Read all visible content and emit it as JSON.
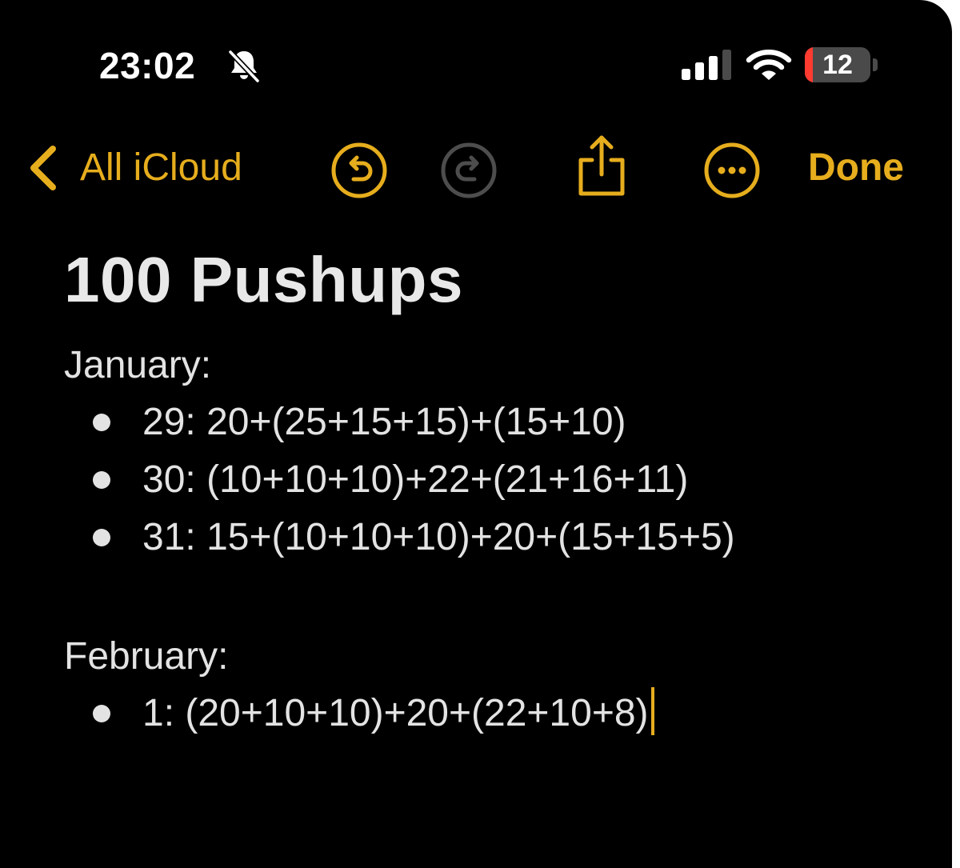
{
  "status_bar": {
    "time": "23:02",
    "silent_icon": "bell-slash-icon",
    "signal_icon": "cellular-signal-icon",
    "wifi_icon": "wifi-icon",
    "battery_percent": 12,
    "battery_label": "12",
    "battery_color": "#ff3b30"
  },
  "toolbar": {
    "back_label": "All iCloud",
    "back_icon": "chevron-left-icon",
    "undo_icon": "undo-icon",
    "redo_icon": "redo-icon",
    "redo_enabled": false,
    "share_icon": "share-icon",
    "more_icon": "more-icon",
    "done_label": "Done",
    "accent_color": "#e6ad1d"
  },
  "note": {
    "title": "100 Pushups",
    "sections": [
      {
        "heading": "January:",
        "entries": [
          "29: 20+(25+15+15)+(15+10)",
          "30: (10+10+10)+22+(21+16+11)",
          "31: 15+(10+10+10)+20+(15+15+5)"
        ]
      },
      {
        "heading": "February:",
        "entries": [
          "1: (20+10+10)+20+(22+10+8)"
        ]
      }
    ]
  }
}
